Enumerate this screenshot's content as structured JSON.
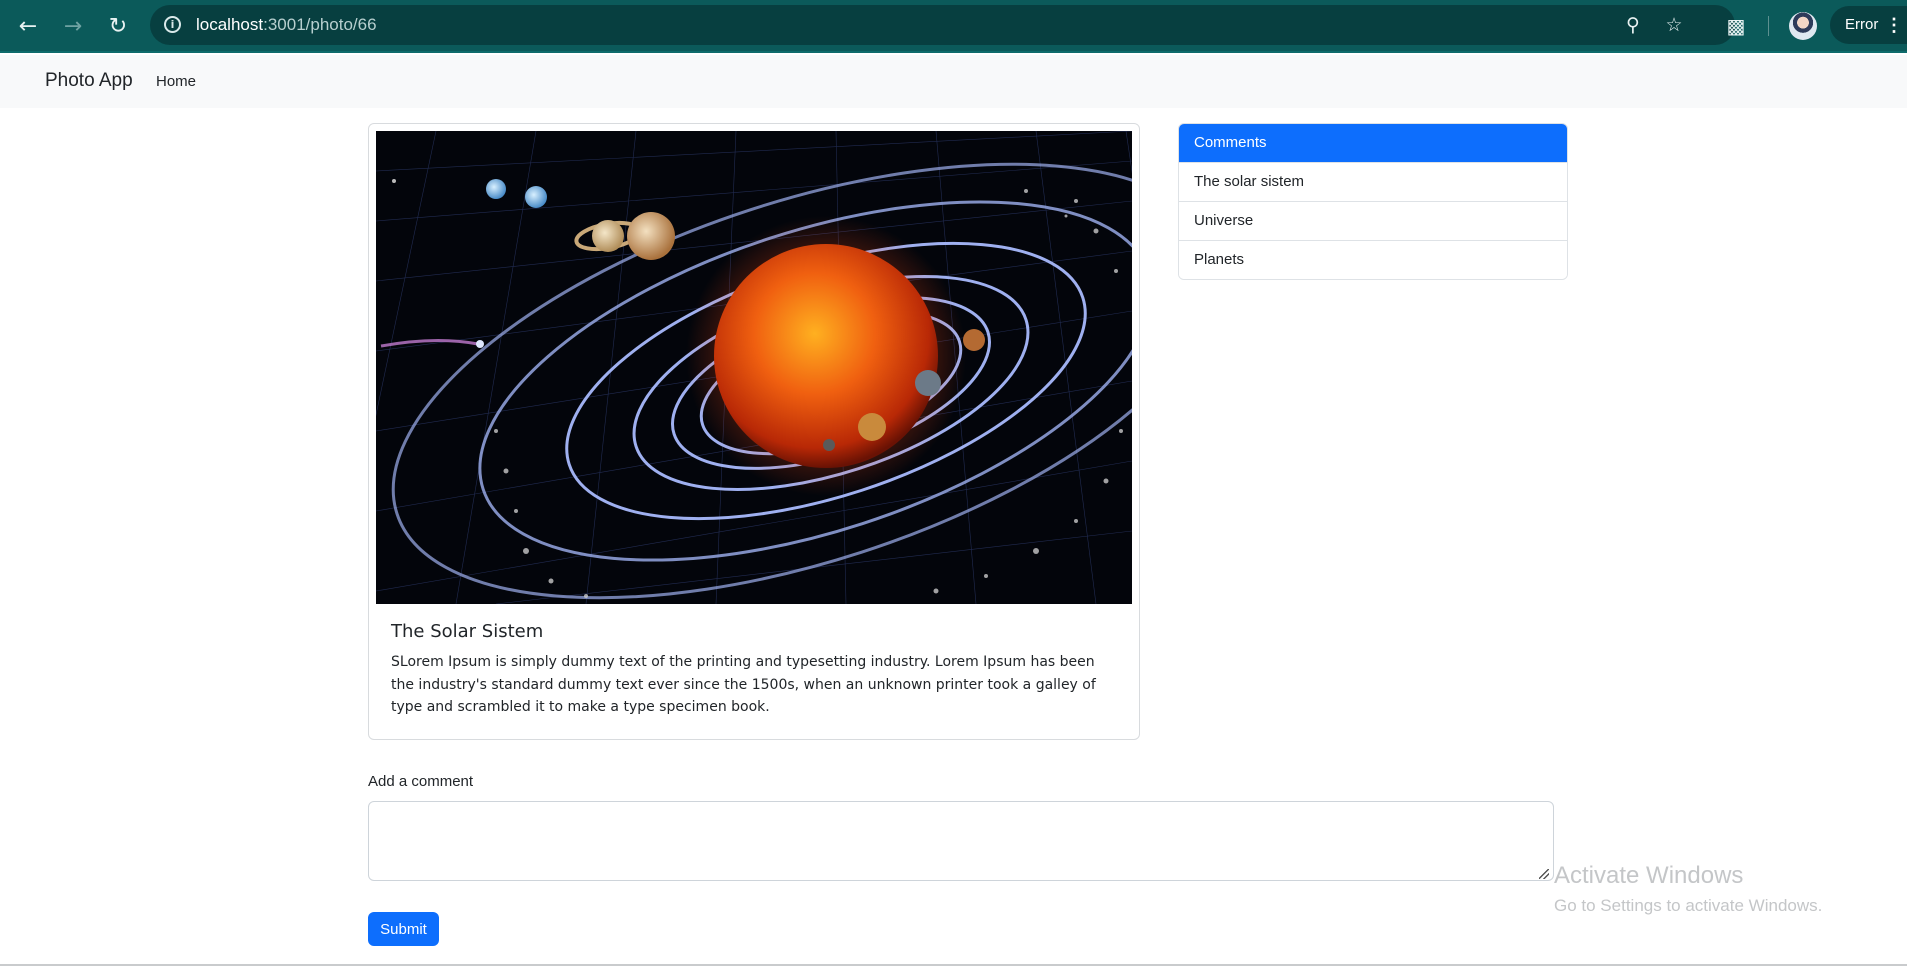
{
  "browser": {
    "url_host": "localhost",
    "url_path": ":3001/photo/66",
    "profile_status": "Error",
    "icons": {
      "back": "back-arrow-icon",
      "forward": "forward-arrow-icon",
      "reload": "reload-icon",
      "site_info": "info-icon",
      "zoom": "zoom-icon",
      "bookmark": "star-icon",
      "extensions": "puzzle-icon",
      "menu": "more-vert-icon"
    }
  },
  "navbar": {
    "brand": "Photo App",
    "links": [
      "Home"
    ]
  },
  "photo": {
    "title": "The Solar Sistem",
    "description": "SLorem Ipsum is simply dummy text of the printing and typesetting industry. Lorem Ipsum has been the industry's standard dummy text ever since the 1500s, when an unknown printer took a galley of type and scrambled it to make a type specimen book."
  },
  "comments": {
    "header": "Comments",
    "items": [
      "The solar sistem",
      "Universe",
      "Planets"
    ]
  },
  "form": {
    "label": "Add a comment",
    "value": "",
    "submit_label": "Submit"
  },
  "watermark": {
    "title": "Activate Windows",
    "subtitle": "Go to Settings to activate Windows."
  },
  "colors": {
    "primary": "#0d6efd",
    "chrome": "#0b5a5a",
    "navbar_bg": "#f8f9fa"
  }
}
